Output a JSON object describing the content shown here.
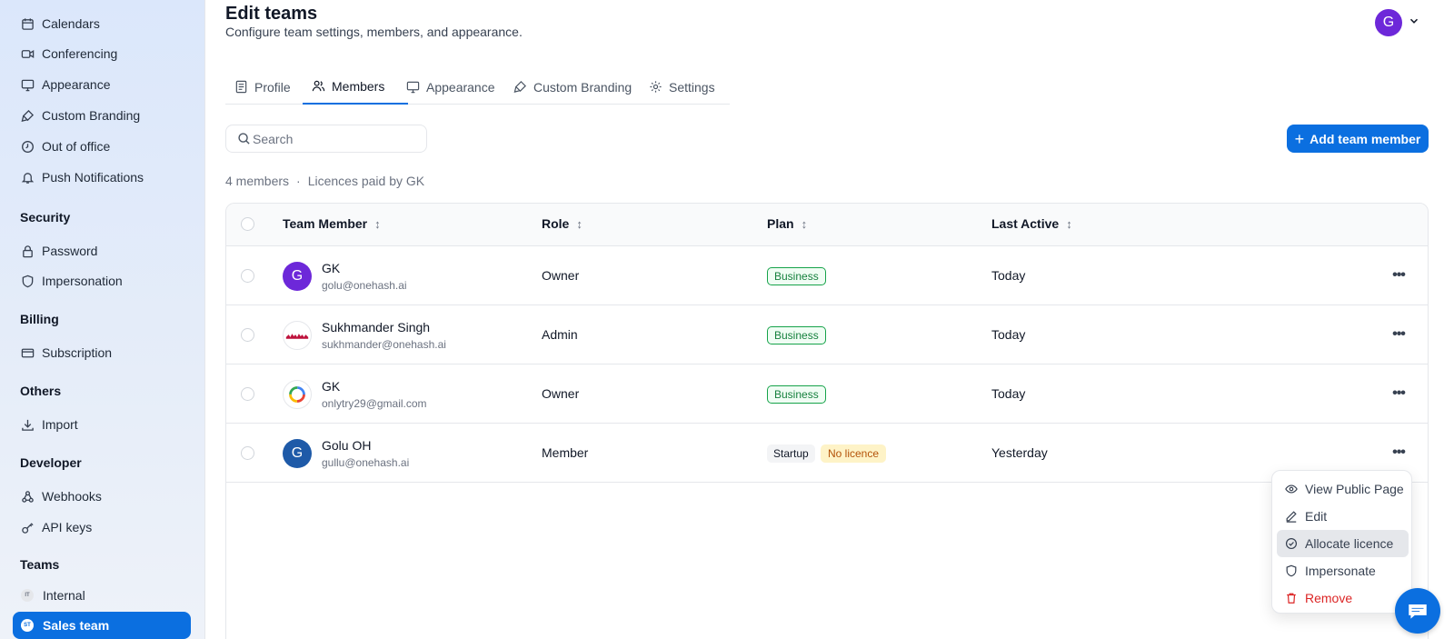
{
  "sidebar": {
    "items_top": [
      {
        "label": "Calendars",
        "icon": "calendar-icon"
      },
      {
        "label": "Conferencing",
        "icon": "video-icon"
      },
      {
        "label": "Appearance",
        "icon": "monitor-icon"
      },
      {
        "label": "Custom Branding",
        "icon": "brush-icon"
      },
      {
        "label": "Out of office",
        "icon": "clock-icon"
      },
      {
        "label": "Push Notifications",
        "icon": "bell-icon"
      }
    ],
    "security": {
      "title": "Security",
      "items": [
        {
          "label": "Password",
          "icon": "lock-icon"
        },
        {
          "label": "Impersonation",
          "icon": "shield-icon"
        }
      ]
    },
    "billing": {
      "title": "Billing",
      "items": [
        {
          "label": "Subscription",
          "icon": "card-icon"
        }
      ]
    },
    "others": {
      "title": "Others",
      "items": [
        {
          "label": "Import",
          "icon": "download-icon"
        }
      ]
    },
    "developer": {
      "title": "Developer",
      "items": [
        {
          "label": "Webhooks",
          "icon": "webhook-icon"
        },
        {
          "label": "API keys",
          "icon": "key-icon"
        }
      ]
    },
    "teams": {
      "title": "Teams",
      "items": [
        {
          "label": "Internal",
          "badge": "IT"
        },
        {
          "label": "Sales team",
          "badge": "ST"
        }
      ]
    }
  },
  "header": {
    "title": "Edit teams",
    "subtitle": "Configure team settings, members, and appearance.",
    "avatar_initial": "G"
  },
  "tabs": [
    "Profile",
    "Members",
    "Appearance",
    "Custom Branding",
    "Settings"
  ],
  "search": {
    "placeholder": "Search"
  },
  "add_button": {
    "label": "Add team member"
  },
  "members_info": {
    "count": "4 members",
    "licence": "Licences paid by GK"
  },
  "table": {
    "headers": [
      "Team Member",
      "Role",
      "Plan",
      "Last Active"
    ],
    "rows": [
      {
        "name": "GK",
        "email": "golu@onehash.ai",
        "role": "Owner",
        "plan": "Business",
        "last_active": "Today",
        "avatar": "G"
      },
      {
        "name": "Sukhmander Singh",
        "email": "sukhmander@onehash.ai",
        "role": "Admin",
        "plan": "Business",
        "last_active": "Today",
        "avatar": ""
      },
      {
        "name": "GK",
        "email": "onlytry29@gmail.com",
        "role": "Owner",
        "plan": "Business",
        "last_active": "Today",
        "avatar": ""
      },
      {
        "name": "Golu OH",
        "email": "gullu@onehash.ai",
        "role": "Member",
        "plan": "Startup",
        "licence_status": "No licence",
        "last_active": "Yesterday",
        "avatar": "G"
      }
    ]
  },
  "row_menu": {
    "items": [
      "View Public Page",
      "Edit",
      "Allocate licence",
      "Impersonate",
      "Remove"
    ]
  },
  "colors": {
    "accent": "#0b6fe0",
    "danger": "#dc2626",
    "business": "#16a34a",
    "no_licence": "#b45309"
  }
}
